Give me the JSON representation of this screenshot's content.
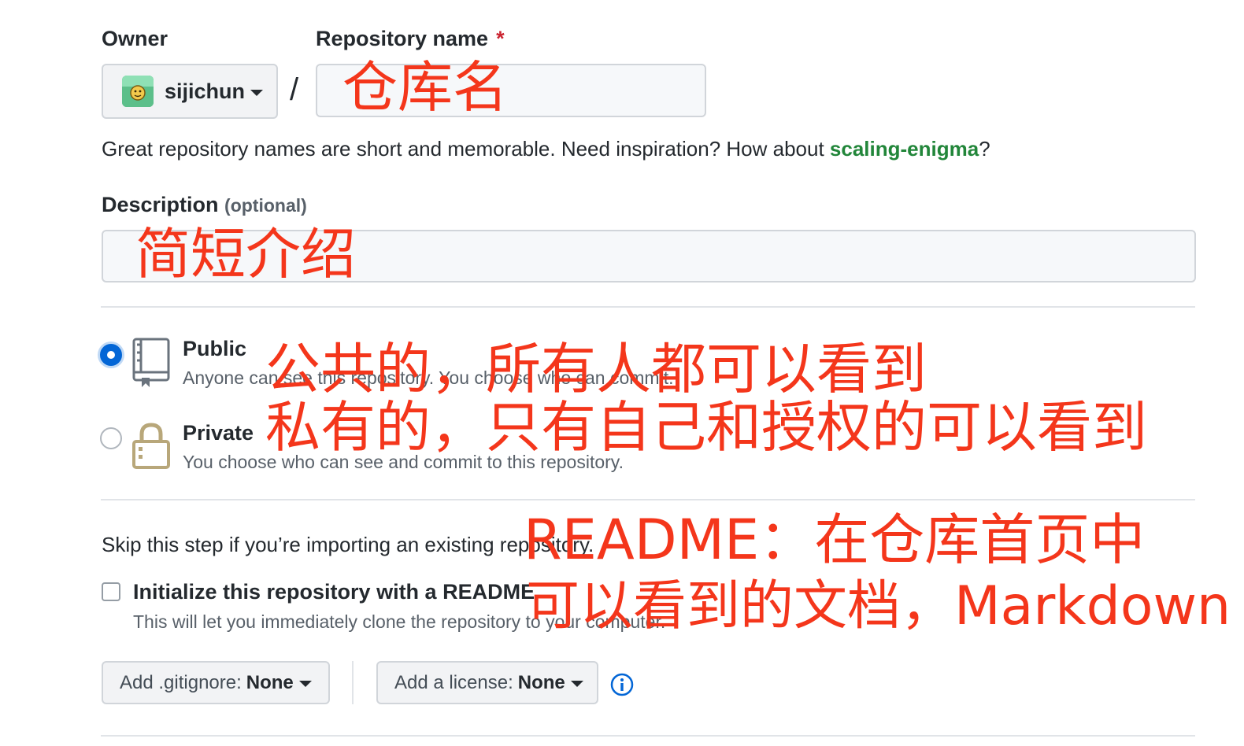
{
  "owner": {
    "label": "Owner",
    "username": "sijichun"
  },
  "separator": "/",
  "repo_name": {
    "label": "Repository name",
    "required_mark": "*",
    "value": ""
  },
  "name_hint": {
    "text": "Great repository names are short and memorable. Need inspiration? How about ",
    "suggestion": "scaling-enigma",
    "suffix": "?"
  },
  "description": {
    "label": "Description",
    "optional": "(optional)",
    "value": ""
  },
  "visibility": {
    "public": {
      "title": "Public",
      "desc": "Anyone can see this repository. You choose who can commit.",
      "selected": true
    },
    "private": {
      "title": "Private",
      "desc": "You choose who can see and commit to this repository.",
      "selected": false
    }
  },
  "init": {
    "skip_text": "Skip this step if you’re importing an existing repository.",
    "readme_label": "Initialize this repository with a README",
    "readme_desc": "This will let you immediately clone the repository to your computer.",
    "readme_checked": false
  },
  "gitignore": {
    "prefix": "Add .gitignore: ",
    "value": "None"
  },
  "license": {
    "prefix": "Add a license: ",
    "value": "None"
  },
  "annotations": {
    "repo_name": "仓库名",
    "description": "简短介绍",
    "public": "公共的，所有人都可以看到",
    "private": "私有的，只有自己和授权的可以看到",
    "readme_1": "README：在仓库首页中",
    "readme_2": "可以看到的文档，Markdown"
  },
  "colors": {
    "accent": "#0366d6",
    "suggestion": "#22863a",
    "required": "#cb2431",
    "annotation": "#f4361b"
  }
}
